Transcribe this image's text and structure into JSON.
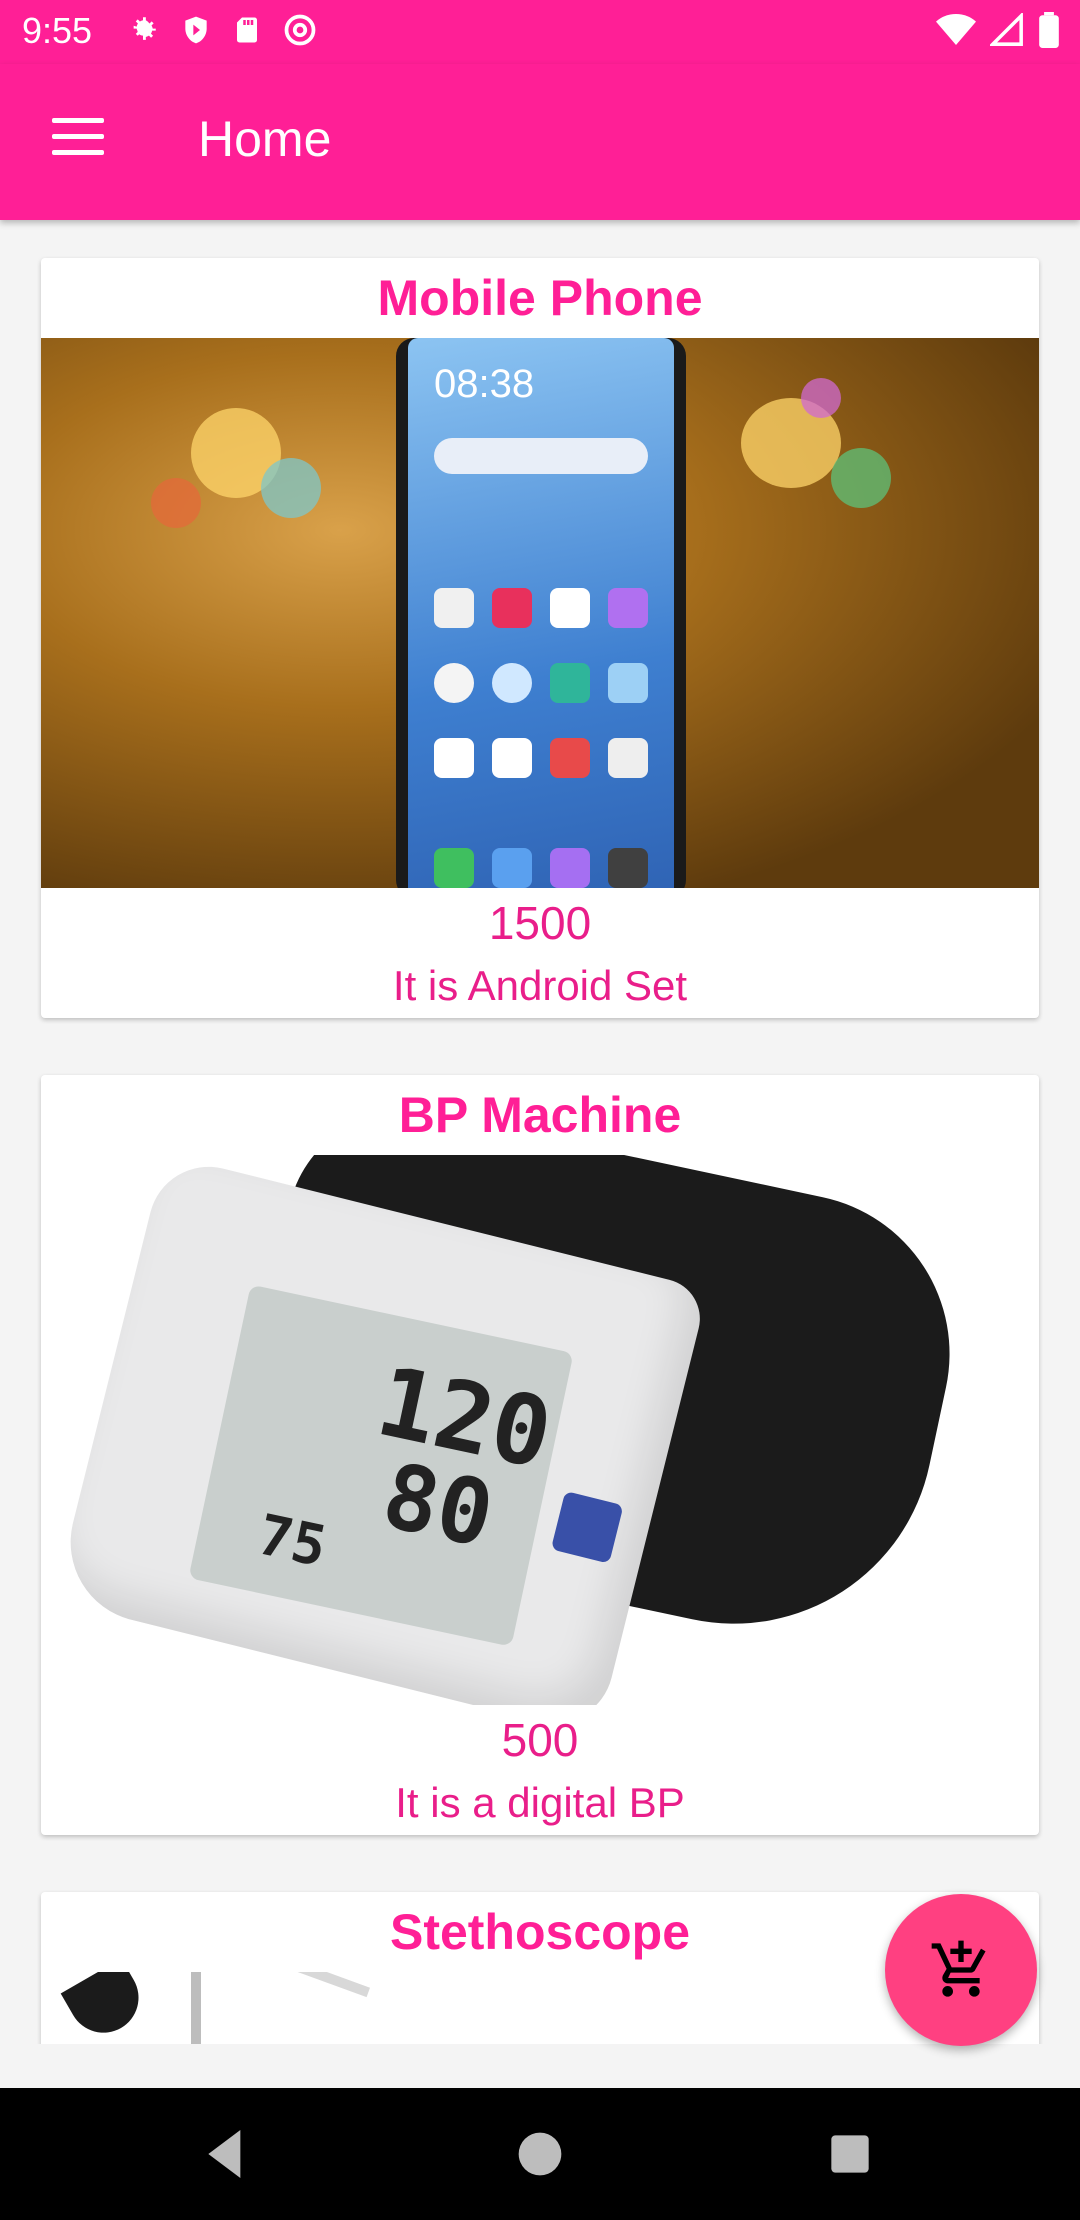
{
  "status_bar": {
    "time": "9:55",
    "icons_left": [
      "gear-icon",
      "shield-icon",
      "sd-card-icon",
      "at-sign-icon"
    ],
    "icons_right": [
      "wifi-icon",
      "cellular-signal-icon",
      "battery-icon"
    ]
  },
  "app_bar": {
    "title": "Home",
    "menu_icon": "hamburger-menu-icon",
    "color": "#ff1f96"
  },
  "products": [
    {
      "title": "Mobile Phone",
      "price": "1500",
      "description": "It is Android Set",
      "image_text": "08:38"
    },
    {
      "title": "BP Machine",
      "price": "500",
      "description": "It is a digital BP",
      "image_text": [
        "120",
        "80",
        "75"
      ]
    },
    {
      "title": "Stethoscope"
    }
  ],
  "fab": {
    "icon": "add-to-cart-icon",
    "color": "#ff4081"
  },
  "nav_bar": {
    "buttons": [
      "back-icon",
      "home-icon",
      "recents-icon"
    ]
  }
}
